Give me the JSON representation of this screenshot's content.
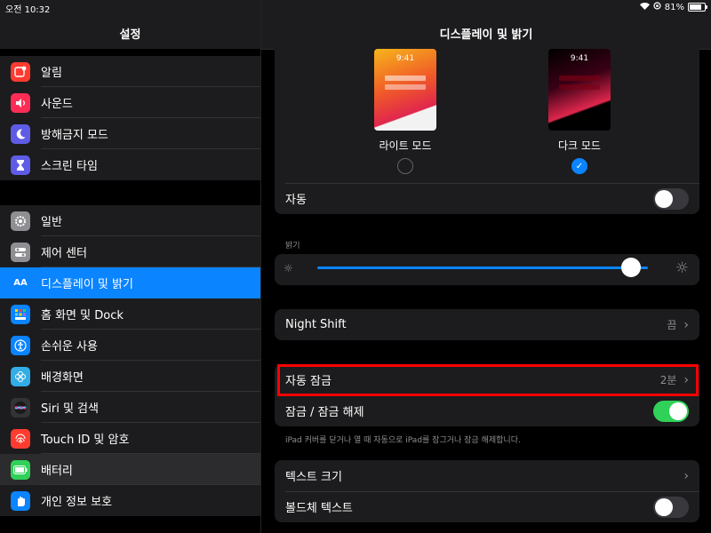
{
  "status": {
    "time": "오전 10:32",
    "battery": "81%",
    "battery_level": 0.81
  },
  "sidebar": {
    "title": "설정",
    "group1": [
      {
        "label": "알림",
        "icon": "notification-icon",
        "color": "#ff3b30"
      },
      {
        "label": "사운드",
        "icon": "speaker-icon",
        "color": "#ff2d55"
      },
      {
        "label": "방해금지 모드",
        "icon": "moon-icon",
        "color": "#5e5ce6"
      },
      {
        "label": "스크린 타임",
        "icon": "hourglass-icon",
        "color": "#5e5ce6"
      }
    ],
    "group2": [
      {
        "label": "일반",
        "icon": "gear-icon",
        "color": "#8e8e93"
      },
      {
        "label": "제어 센터",
        "icon": "toggles-icon",
        "color": "#8e8e93"
      },
      {
        "label": "디스플레이 및 밝기",
        "icon": "text-size-icon",
        "color": "#0a84ff",
        "active": true
      },
      {
        "label": "홈 화면 및 Dock",
        "icon": "grid-icon",
        "color": "#0a84ff"
      },
      {
        "label": "손쉬운 사용",
        "icon": "accessibility-icon",
        "color": "#0a84ff"
      },
      {
        "label": "배경화면",
        "icon": "flower-icon",
        "color": "#32ade6"
      },
      {
        "label": "Siri 및 검색",
        "icon": "siri-icon",
        "color": "#333333"
      },
      {
        "label": "Touch ID 및 암호",
        "icon": "fingerprint-icon",
        "color": "#ff3b30"
      },
      {
        "label": "배터리",
        "icon": "battery-icon",
        "color": "#30d158",
        "dim": true
      },
      {
        "label": "개인 정보 보호",
        "icon": "hand-icon",
        "color": "#0a84ff"
      }
    ]
  },
  "main": {
    "title": "디스플레이 및 밝기",
    "appearance": {
      "light_time": "9:41",
      "dark_time": "9:41",
      "light_label": "라이트 모드",
      "dark_label": "다크 모드",
      "selected": "dark"
    },
    "auto_label": "자동",
    "auto_on": false,
    "brightness_label": "밝기",
    "brightness_level": 0.95,
    "night_shift": {
      "label": "Night Shift",
      "value": "끔"
    },
    "auto_lock": {
      "label": "자동 잠금",
      "value": "2분"
    },
    "lock_unlock": {
      "label": "잠금 / 잠금 해제",
      "on": true
    },
    "lock_note": "iPad 커버를 닫거나 열 때 자동으로 iPad를 잠그거나 잠금 해제합니다.",
    "text_size_label": "텍스트 크기",
    "bold_text": {
      "label": "볼드체 텍스트",
      "on": false
    }
  }
}
